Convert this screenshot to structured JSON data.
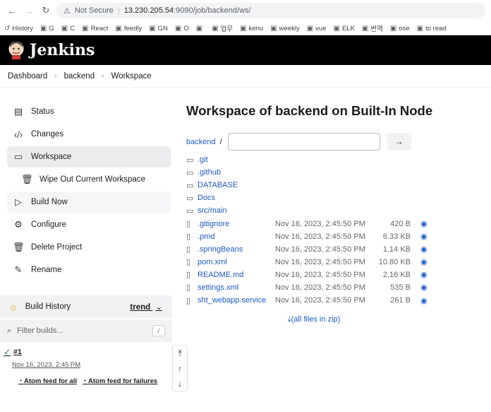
{
  "browser": {
    "url_host": "13.230.205.54",
    "url_path": ":9090/job/backend/ws/",
    "security": "Not Secure",
    "bookmarks": [
      "History",
      "G",
      "C",
      "React",
      "feedly",
      "GN",
      "O",
      "",
      "업무",
      "kenu",
      "weekly",
      "vue",
      "ELK",
      "번역",
      "ose",
      "to read"
    ]
  },
  "header": {
    "title": "Jenkins"
  },
  "breadcrumb": [
    "Dashboard",
    "backend",
    "Workspace"
  ],
  "sidebar": {
    "items": [
      {
        "label": "Status",
        "icon": "document-icon"
      },
      {
        "label": "Changes",
        "icon": "code-icon"
      },
      {
        "label": "Workspace",
        "icon": "folder-icon"
      },
      {
        "label": "Wipe Out Current Workspace",
        "icon": "trash-icon"
      },
      {
        "label": "Build Now",
        "icon": "play-icon"
      },
      {
        "label": "Configure",
        "icon": "gear-icon"
      },
      {
        "label": "Delete Project",
        "icon": "trash-icon"
      },
      {
        "label": "Rename",
        "icon": "pencil-icon"
      }
    ]
  },
  "build_history": {
    "title": "Build History",
    "trend": "trend",
    "filter_placeholder": "Filter builds...",
    "shortcut": "/",
    "builds": [
      {
        "number": "#1",
        "date": "Nov 16, 2023, 2:45 PM"
      }
    ],
    "feed_all": "Atom feed for all",
    "feed_failures": "Atom feed for failures"
  },
  "main": {
    "title": "Workspace of backend on Built-In Node",
    "path_root": "backend",
    "path_sep": "/",
    "go": "→",
    "zip": "(all files in zip)",
    "entries": [
      {
        "name": ".git",
        "type": "folder"
      },
      {
        "name": ".github",
        "type": "folder"
      },
      {
        "name": "DATABASE",
        "type": "folder"
      },
      {
        "name": "Docs",
        "type": "folder"
      },
      {
        "name": "src/main",
        "type": "folder"
      },
      {
        "name": ".gitignore",
        "type": "file",
        "date": "Nov 16, 2023, 2:45:50 PM",
        "size": "420 B"
      },
      {
        "name": ".pmd",
        "type": "file",
        "date": "Nov 16, 2023, 2:45:50 PM",
        "size": "6.33 KB"
      },
      {
        "name": ".springBeans",
        "type": "file",
        "date": "Nov 16, 2023, 2:45:50 PM",
        "size": "1.14 KB"
      },
      {
        "name": "pom.xml",
        "type": "file",
        "date": "Nov 16, 2023, 2:45:50 PM",
        "size": "10.80 KB"
      },
      {
        "name": "README.md",
        "type": "file",
        "date": "Nov 16, 2023, 2:45:50 PM",
        "size": "2.16 KB"
      },
      {
        "name": "settings.xml",
        "type": "file",
        "date": "Nov 16, 2023, 2:45:50 PM",
        "size": "535 B"
      },
      {
        "name": "sht_webapp.service",
        "type": "file",
        "date": "Nov 16, 2023, 2:45:50 PM",
        "size": "261 B"
      }
    ]
  }
}
